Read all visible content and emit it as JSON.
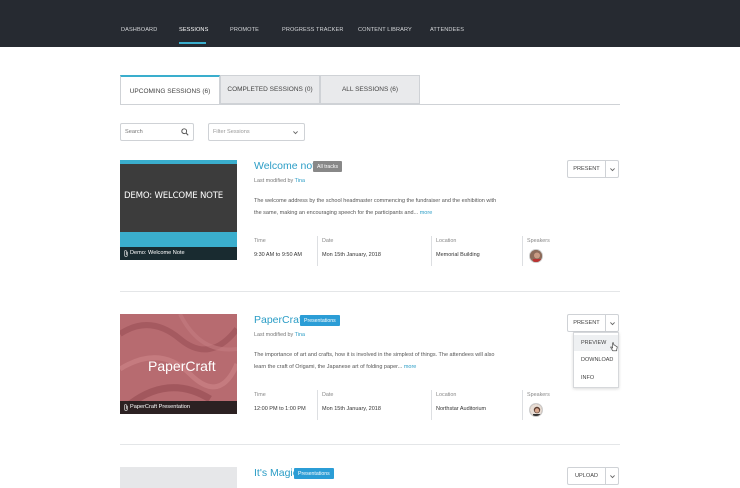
{
  "nav": {
    "items": [
      "DASHBOARD",
      "SESSIONS",
      "PROMOTE",
      "PROGRESS TRACKER",
      "CONTENT LIBRARY",
      "ATTENDEES"
    ],
    "active": "SESSIONS"
  },
  "tabs": [
    "UPCOMING SESSIONS (6)",
    "COMPLETED SESSIONS (0)",
    "ALL SESSIONS (6)"
  ],
  "search": {
    "placeholder": "Search",
    "icon": "search-icon"
  },
  "filter": {
    "placeholder": "Filter Sessions",
    "icon": "chevron-down-icon"
  },
  "colors": {
    "accent": "#2b9dc6",
    "nav_bg": "#262a31",
    "badge_blue": "#2b9dd6",
    "badge_grey": "#888888"
  },
  "meta_labels": {
    "time": "Time",
    "date": "Date",
    "location": "Location",
    "speakers": "Speakers"
  },
  "sessions": [
    {
      "title": "Welcome note",
      "badge": "All tracks",
      "modified_prefix": "Last modified by",
      "modified_by": "Tina",
      "description": "The welcome address by the school headmaster commencing the fundraiser and the exhibition with the same, making an encouraging speech for the participants and...",
      "more": "more",
      "thumb_text": "DEMO: WELCOME NOTE",
      "thumb_caption": "Demo: Welcome Note",
      "time": "9:30 AM to 9:50 AM",
      "date": "Mon 15th January, 2018",
      "location": "Memorial Building",
      "action": "PRESENT"
    },
    {
      "title": "PaperCraft",
      "badge": "Presentations",
      "modified_prefix": "Last modified by",
      "modified_by": "Tina",
      "description": "The importance of art and crafts, how it is involved in the simplest of things. The attendees will also learn the craft of Origami, the Japanese art of folding paper...",
      "more": "more",
      "thumb_text": "PaperCraft",
      "thumb_caption": "PaperCraft Presentation",
      "time": "12:00 PM to 1:00 PM",
      "date": "Mon 15th January, 2018",
      "location": "Northstar Auditorium",
      "action": "PRESENT"
    },
    {
      "title": "It's Magic",
      "badge": "Presentations",
      "action": "UPLOAD"
    }
  ],
  "dropdown": [
    "PREVIEW",
    "DOWNLOAD",
    "INFO"
  ]
}
